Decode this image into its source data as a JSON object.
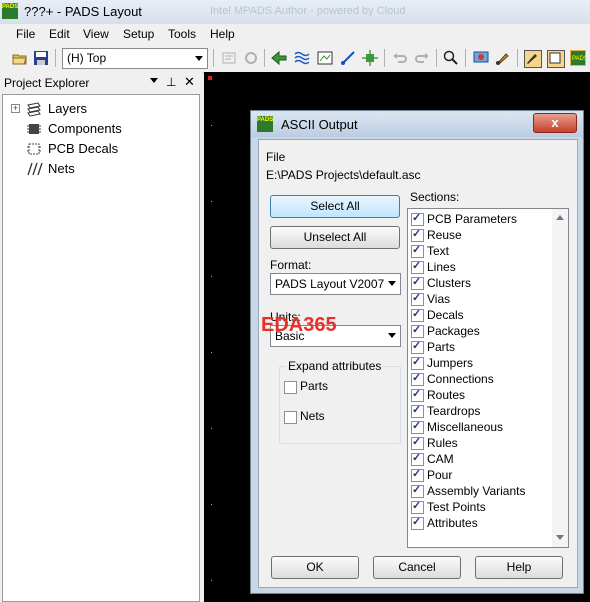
{
  "window": {
    "title": "???+ - PADS Layout",
    "title_ghost": "Intel MPADS Author - powered by Cloud",
    "icon_text": "PADS"
  },
  "menu": [
    {
      "label": "File"
    },
    {
      "label": "Edit"
    },
    {
      "label": "View"
    },
    {
      "label": "Setup"
    },
    {
      "label": "Tools"
    },
    {
      "label": "Help"
    }
  ],
  "toolbar": {
    "layer_value": "(H) Top"
  },
  "explorer": {
    "title": "Project Explorer",
    "items": [
      {
        "label": "Layers",
        "icon": "layers-icon"
      },
      {
        "label": "Components",
        "icon": "components-icon"
      },
      {
        "label": "PCB Decals",
        "icon": "pcb-decals-icon"
      },
      {
        "label": "Nets",
        "icon": "nets-icon"
      }
    ]
  },
  "dialog": {
    "title": "ASCII Output",
    "icon_text": "PADS",
    "close_label": "x",
    "file_label": "File",
    "file_path": "E:\\PADS Projects\\default.asc",
    "select_all": "Select All",
    "unselect_all": "Unselect All",
    "format_label": "Format:",
    "format_value": "PADS Layout V2007",
    "units_label": "Units:",
    "units_value": "Basic",
    "expand_label": "Expand attributes",
    "expand_parts": "Parts",
    "expand_nets": "Nets",
    "sections_label": "Sections:",
    "sections": [
      {
        "label": "PCB Parameters",
        "checked": true
      },
      {
        "label": "Reuse",
        "checked": true
      },
      {
        "label": "Text",
        "checked": true
      },
      {
        "label": "Lines",
        "checked": true
      },
      {
        "label": "Clusters",
        "checked": true
      },
      {
        "label": "Vias",
        "checked": true
      },
      {
        "label": "Decals",
        "checked": true
      },
      {
        "label": "Packages",
        "checked": true
      },
      {
        "label": "Parts",
        "checked": true
      },
      {
        "label": "Jumpers",
        "checked": true
      },
      {
        "label": "Connections",
        "checked": true
      },
      {
        "label": "Routes",
        "checked": true
      },
      {
        "label": "Teardrops",
        "checked": true
      },
      {
        "label": "Miscellaneous",
        "checked": true
      },
      {
        "label": "Rules",
        "checked": true
      },
      {
        "label": "CAM",
        "checked": true
      },
      {
        "label": "Pour",
        "checked": true
      },
      {
        "label": "Assembly Variants",
        "checked": true
      },
      {
        "label": "Test Points",
        "checked": true
      },
      {
        "label": "Attributes",
        "checked": true
      }
    ],
    "ok": "OK",
    "cancel": "Cancel",
    "help": "Help"
  },
  "watermark": "EDA365"
}
